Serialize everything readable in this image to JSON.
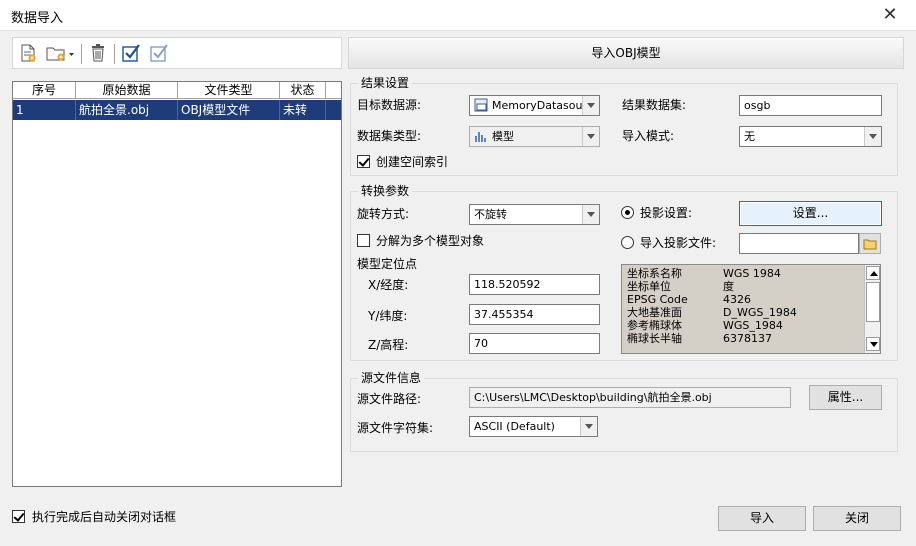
{
  "window": {
    "title": "数据导入"
  },
  "banner": {
    "text": "导入OBJ模型"
  },
  "list": {
    "headers": [
      "序号",
      "原始数据",
      "文件类型",
      "状态"
    ],
    "rows": [
      {
        "index": "1",
        "source": "航拍全景.obj",
        "type": "OBJ模型文件",
        "status": "未转"
      }
    ]
  },
  "result_settings": {
    "legend": "结果设置",
    "target_datasource_label": "目标数据源:",
    "target_datasource_value": "MemoryDatasour",
    "result_dataset_label": "结果数据集:",
    "result_dataset_value": "osgb",
    "dataset_type_label": "数据集类型:",
    "dataset_type_value": "模型",
    "import_mode_label": "导入模式:",
    "import_mode_value": "无",
    "spatial_index_label": "创建空间索引",
    "spatial_index_checked": true
  },
  "conversion": {
    "legend": "转换参数",
    "rotation_label": "旋转方式:",
    "rotation_value": "不旋转",
    "split_label": "分解为多个模型对象",
    "split_checked": false,
    "position_label": "模型定位点",
    "x_label": "X/经度:",
    "x_value": "118.520592",
    "y_label": "Y/纬度:",
    "y_value": "37.455354",
    "z_label": "Z/高程:",
    "z_value": "70",
    "projection_settings_label": "投影设置:",
    "projection_settings_selected": true,
    "settings_button": "设置...",
    "import_projection_label": "导入投影文件:",
    "import_projection_value": "",
    "projection_info": [
      {
        "key": "坐标系名称",
        "value": "WGS 1984"
      },
      {
        "key": "坐标单位",
        "value": "度"
      },
      {
        "key": "EPSG Code",
        "value": "4326"
      },
      {
        "key": "大地基准面",
        "value": "D_WGS_1984"
      },
      {
        "key": "参考椭球体",
        "value": "WGS_1984"
      },
      {
        "key": "椭球长半轴",
        "value": "6378137"
      }
    ]
  },
  "source_info": {
    "legend": "源文件信息",
    "path_label": "源文件路径:",
    "path_value": "C:\\Users\\LMC\\Desktop\\building\\航拍全景.obj",
    "properties_button": "属性...",
    "charset_label": "源文件字符集:",
    "charset_value": "ASCII (Default)"
  },
  "footer": {
    "auto_close_label": "执行完成后自动关闭对话框",
    "auto_close_checked": true,
    "import_button": "导入",
    "close_button": "关闭"
  },
  "colors": {
    "selection": "#1e3c7a",
    "accent": "#0078d7"
  }
}
